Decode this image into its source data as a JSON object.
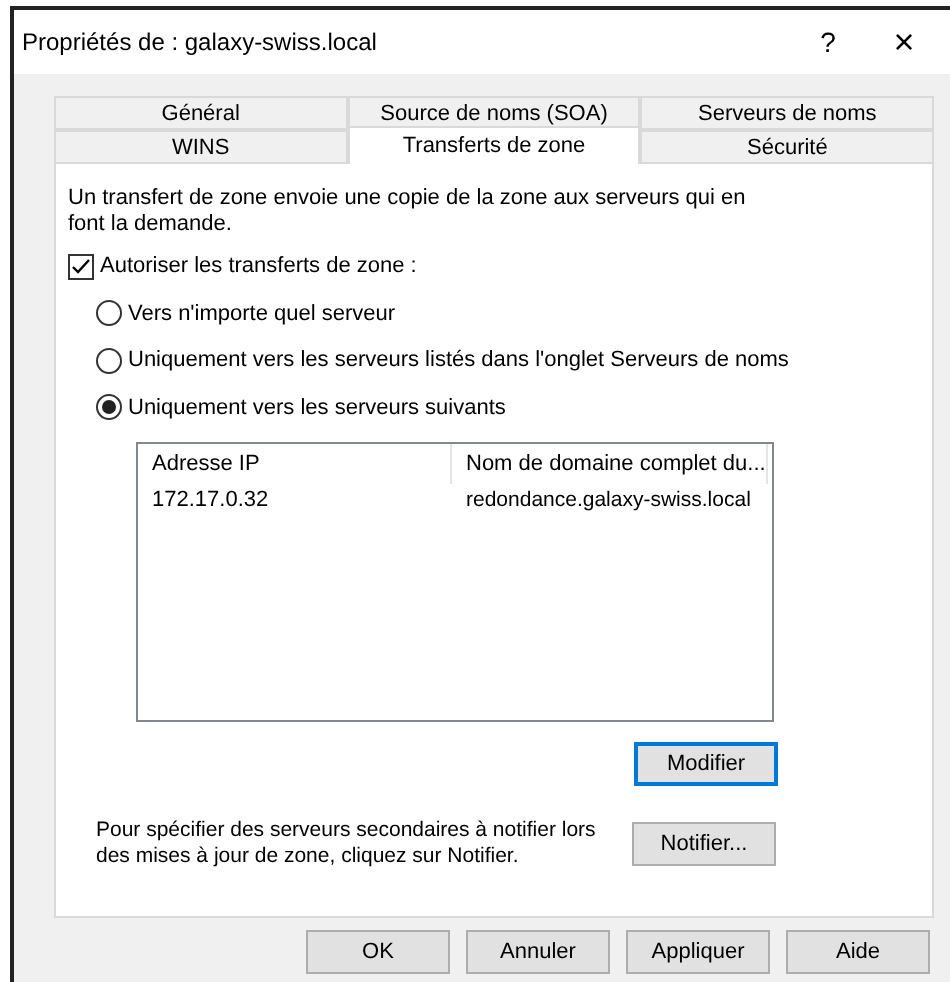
{
  "window": {
    "title": "Propriétés de : galaxy-swiss.local",
    "help": "?",
    "close": "×"
  },
  "tab_rows": [
    [
      {
        "label": "Général",
        "selected": false
      },
      {
        "label": "Source de noms (SOA)",
        "selected": false
      },
      {
        "label": "Serveurs de noms",
        "selected": false
      }
    ],
    [
      {
        "label": "WINS",
        "selected": false
      },
      {
        "label": "Transferts de zone",
        "selected": true
      },
      {
        "label": "Sécurité",
        "selected": false
      }
    ]
  ],
  "description": "Un transfert de zone envoie une copie de la zone aux serveurs qui en font la demande.",
  "allow": {
    "label": "Autoriser les transferts de zone :",
    "checked": true
  },
  "options": [
    {
      "label": "Vers n'importe quel serveur",
      "selected": false
    },
    {
      "label": "Uniquement vers les serveurs listés dans l'onglet Serveurs de noms",
      "selected": false
    },
    {
      "label": "Uniquement vers les serveurs suivants",
      "selected": true
    }
  ],
  "table": {
    "columns": [
      "Adresse IP",
      "Nom de domaine complet du..."
    ],
    "rows": [
      [
        "172.17.0.32",
        "redondance.galaxy-swiss.local"
      ]
    ]
  },
  "modify_button": {
    "label": "Modifier",
    "focused": true
  },
  "notify_text": "Pour spécifier des serveurs secondaires à notifier lors des mises à jour de zone, cliquez sur Notifier.",
  "notify_button": "Notifier...",
  "buttons": [
    "OK",
    "Annuler",
    "Appliquer",
    "Aide"
  ]
}
